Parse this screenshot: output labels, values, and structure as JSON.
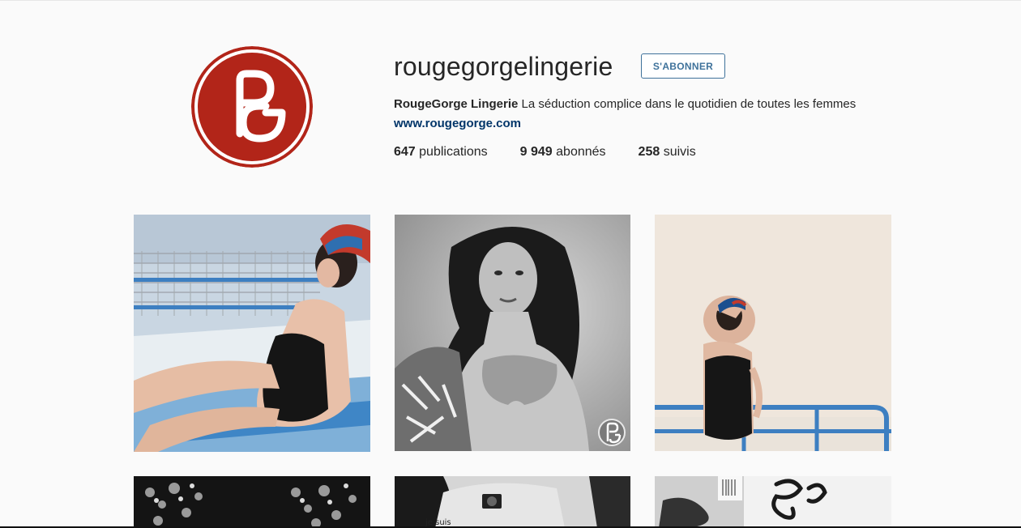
{
  "profile": {
    "username": "rougegorgelingerie",
    "follow_label": "S'ABONNER",
    "full_name": "RougeGorge Lingerie",
    "bio_text": "La séduction complice dans le quotidien de toutes les femmes",
    "website": "www.rougegorge.com",
    "logo_color": "#b22519"
  },
  "stats": {
    "posts_count": "647",
    "posts_label": "publications",
    "followers_count": "9 949",
    "followers_label": "abonnés",
    "following_count": "258",
    "following_label": "suivis"
  },
  "posts": [
    {
      "description": "woman in black swimsuit by pool fence",
      "tone": "color"
    },
    {
      "description": "black and white portrait in lace bra",
      "tone": "bw"
    },
    {
      "description": "woman in black bodysuit against wall",
      "tone": "color"
    },
    {
      "description": "patterned lingerie on black",
      "tone": "bw"
    },
    {
      "description": "back with je suis text",
      "tone": "bw"
    },
    {
      "description": "white tshirt with lettering",
      "tone": "light"
    }
  ],
  "overlay": {
    "post2_text": "je suis"
  }
}
